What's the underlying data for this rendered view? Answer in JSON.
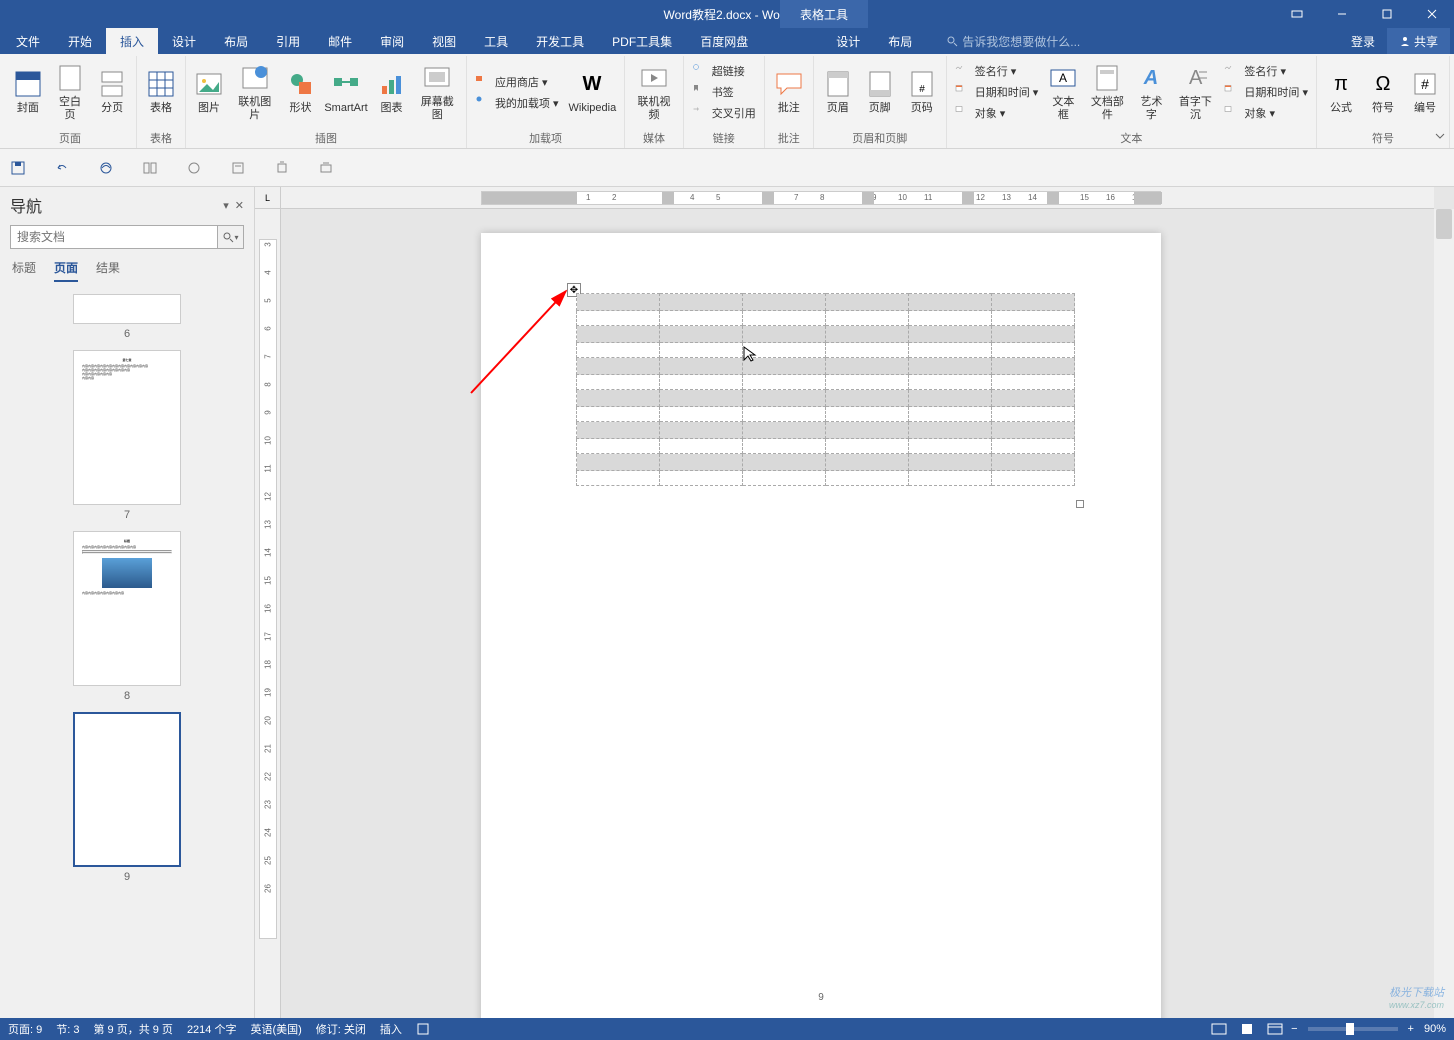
{
  "title": {
    "document": "Word教程2.docx",
    "app": "Word",
    "tool_tab": "表格工具"
  },
  "window_controls": {
    "minimize": "—",
    "maximize": "❐",
    "close": "✕",
    "ribbon_opts": "▭"
  },
  "tabs": {
    "items": [
      "文件",
      "开始",
      "插入",
      "设计",
      "布局",
      "引用",
      "邮件",
      "审阅",
      "视图",
      "工具",
      "开发工具",
      "PDF工具集",
      "百度网盘",
      "设计",
      "布局"
    ],
    "active_index": 2,
    "tell_me": "告诉我您想要做什么...",
    "login": "登录",
    "share": "共享"
  },
  "ribbon": {
    "groups": [
      {
        "label": "页面",
        "items": [
          {
            "lbl": "封面",
            "icon": "cover"
          },
          {
            "lbl": "空白页",
            "icon": "blank"
          },
          {
            "lbl": "分页",
            "icon": "break"
          }
        ]
      },
      {
        "label": "表格",
        "items": [
          {
            "lbl": "表格",
            "icon": "table"
          }
        ]
      },
      {
        "label": "插图",
        "items": [
          {
            "lbl": "图片",
            "icon": "picture"
          },
          {
            "lbl": "联机图片",
            "icon": "onlinepic"
          },
          {
            "lbl": "形状",
            "icon": "shapes"
          },
          {
            "lbl": "SmartArt",
            "icon": "smartart"
          },
          {
            "lbl": "图表",
            "icon": "chart"
          },
          {
            "lbl": "屏幕截图",
            "icon": "screenshot"
          }
        ]
      },
      {
        "label": "加载项",
        "items_small": [
          {
            "lbl": "应用商店",
            "icon": "store"
          },
          {
            "lbl": "我的加载项",
            "icon": "addins"
          }
        ],
        "items": [
          {
            "lbl": "Wikipedia",
            "icon": "wiki"
          }
        ]
      },
      {
        "label": "媒体",
        "items": [
          {
            "lbl": "联机视频",
            "icon": "video"
          }
        ]
      },
      {
        "label": "链接",
        "items_small": [
          {
            "lbl": "超链接",
            "icon": "hyperlink"
          },
          {
            "lbl": "书签",
            "icon": "bookmark"
          },
          {
            "lbl": "交叉引用",
            "icon": "crossref"
          }
        ]
      },
      {
        "label": "批注",
        "items": [
          {
            "lbl": "批注",
            "icon": "comment"
          }
        ]
      },
      {
        "label": "页眉和页脚",
        "items": [
          {
            "lbl": "页眉",
            "icon": "header"
          },
          {
            "lbl": "页脚",
            "icon": "footer"
          },
          {
            "lbl": "页码",
            "icon": "pagenum"
          }
        ]
      },
      {
        "label": "文本",
        "items": [
          {
            "lbl": "文本框",
            "icon": "textbox"
          },
          {
            "lbl": "文档部件",
            "icon": "quickparts"
          },
          {
            "lbl": "艺术字",
            "icon": "wordart"
          },
          {
            "lbl": "首字下沉",
            "icon": "dropcap"
          }
        ],
        "items_small": [
          {
            "lbl": "签名行",
            "icon": "sig"
          },
          {
            "lbl": "日期和时间",
            "icon": "datetime"
          },
          {
            "lbl": "对象",
            "icon": "object"
          }
        ]
      },
      {
        "label": "符号",
        "items": [
          {
            "lbl": "公式",
            "icon": "equation"
          },
          {
            "lbl": "符号",
            "icon": "symbol"
          },
          {
            "lbl": "编号",
            "icon": "number"
          }
        ]
      }
    ]
  },
  "navigation": {
    "title": "导航",
    "search_placeholder": "搜索文档",
    "tabs": [
      "标题",
      "页面",
      "结果"
    ],
    "active_tab": 1,
    "pages": [
      {
        "num": 6,
        "type": "small"
      },
      {
        "num": 7,
        "type": "full"
      },
      {
        "num": 8,
        "type": "full"
      },
      {
        "num": 9,
        "type": "full",
        "selected": true
      }
    ]
  },
  "document": {
    "current_page_number": "9",
    "table": {
      "rows": 12,
      "cols": 6
    }
  },
  "status": {
    "page": "页面: 9",
    "section": "节: 3",
    "page_of": "第 9 页，共 9 页",
    "words": "2214 个字",
    "language": "英语(美国)",
    "track": "修订: 关闭",
    "mode": "插入",
    "zoom": "90%"
  },
  "watermark": {
    "main": "极光下载站",
    "sub": "www.xz7.com"
  }
}
